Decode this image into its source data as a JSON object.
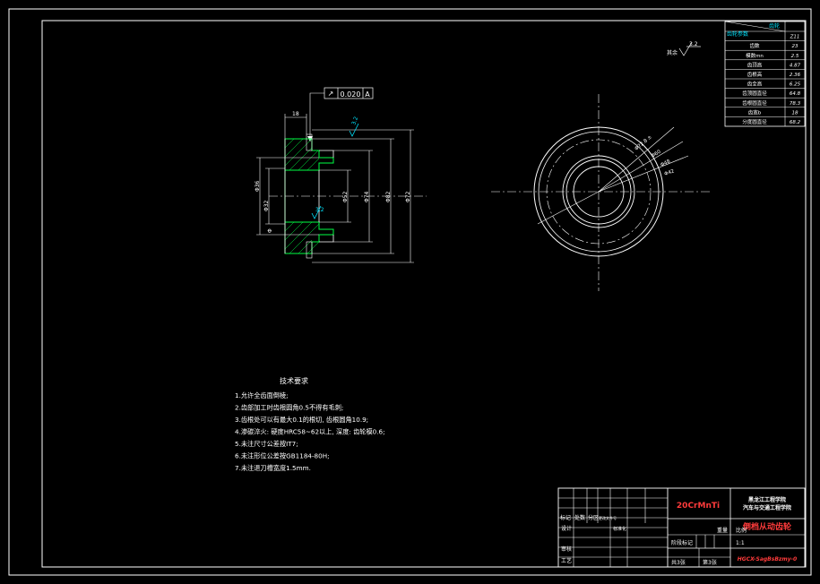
{
  "colors": {
    "background": "#000000",
    "line": "#ffffff",
    "hatch": "#00ff44",
    "accent": "#00e5ff",
    "title_red": "#ff3b3b"
  },
  "param_table": {
    "header_left": "齿轮参数",
    "header_right": "齿轮",
    "rows": [
      {
        "label": "模数m",
        "value": "Z11"
      },
      {
        "label": "齿数",
        "value": "23"
      },
      {
        "label": "模数mn",
        "value": "2.5"
      },
      {
        "label": "齿顶高",
        "value": "4.87"
      },
      {
        "label": "齿根高",
        "value": "2.36"
      },
      {
        "label": "齿全高",
        "value": "6.25"
      },
      {
        "label": "齿顶圆直径",
        "value": "64.8"
      },
      {
        "label": "齿根圆直径",
        "value": "78.3"
      },
      {
        "label": "齿宽b",
        "value": "18"
      },
      {
        "label": "分度圆直径",
        "value": "68.2"
      }
    ]
  },
  "surface_note": {
    "label": "其余",
    "roughness": "3.2"
  },
  "tolerance_frame": {
    "symbol": "↗",
    "value": "0.020",
    "datum": "A"
  },
  "section_view": {
    "dim_top": "18",
    "dim_left": "Φ32",
    "dim_left2": "Φ36",
    "dim_inner": "Φ52",
    "dim_mid": "Φ74",
    "dim_outer": "Φ82",
    "dim_max": "Φ72",
    "rough_top": "3.2",
    "rough_mid": "3.2",
    "phi_mark": "Φ"
  },
  "front_view": {
    "callouts": [
      "Φ72.8 ±",
      "Φ60",
      "Φ48",
      "Φ42"
    ]
  },
  "tech_requirements": {
    "title": "技术要求",
    "items": [
      "1.允许全齿面倒棱;",
      "2.齿部加工时齿根圆角0.5不得有毛刺;",
      "3.齿根处可以有最大0.1的根切, 齿根圆角10.9;",
      "4.渗碳淬火: 硬度HRC58~62以上, 深度: 齿轮模0.6;",
      "5.未注尺寸公差按IT7;",
      "6.未注形位公差按GB1184-80H;",
      "7.未注退刀槽宽度1.5mm."
    ]
  },
  "title_block": {
    "material": "20CrMnTi",
    "school_line1": "黑龙江工程学院",
    "school_line2": "汽车与交通工程学院",
    "drawing_name": "倒档从动齿轮",
    "drawing_code": "HGCX-SagBsBzmy-0",
    "rows_left": [
      "标记",
      "处数",
      "分区",
      "更改文件号"
    ],
    "designer": "设计",
    "standard": "标准化",
    "reviewer": "审核",
    "process": "工艺",
    "stage_label": "阶段标记",
    "weight_label": "重量",
    "scale_label": "比例",
    "scale_value": "1:1",
    "sheets_total": "共3张",
    "sheet_no": "第3张"
  }
}
